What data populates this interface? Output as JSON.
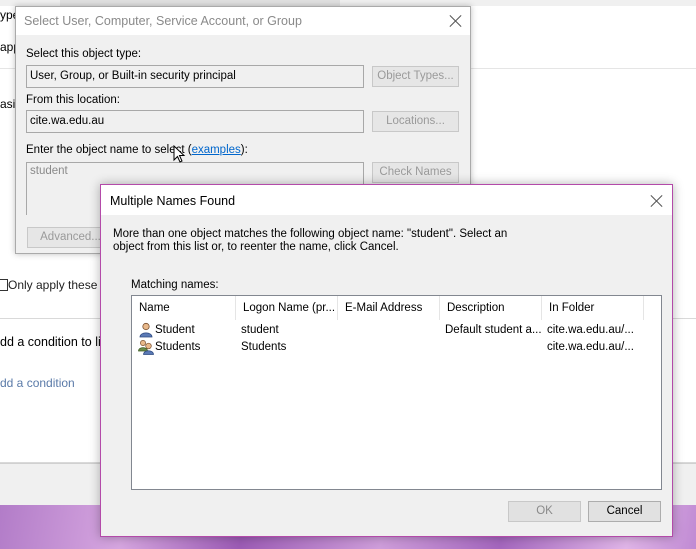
{
  "background": {
    "fragments": {
      "typ": "ype",
      "app": "app",
      "asi": "asi",
      "only_apply": "Only apply these p",
      "add_condition_to": "dd a condition to li",
      "add_condition": "dd a condition"
    }
  },
  "select_dialog": {
    "title": "Select User, Computer, Service Account, or Group",
    "object_type_label": "Select this object type:",
    "object_type_value": "User, Group, or Built-in security principal",
    "object_types_button": "Object Types...",
    "location_label": "From this location:",
    "location_value": "cite.wa.edu.au",
    "locations_button": "Locations...",
    "enter_name_label": "Enter the object name to select (",
    "examples_link": "examples",
    "enter_name_suffix": "):",
    "name_value": "student",
    "check_names_button": "Check Names",
    "advanced_button": "Advanced..."
  },
  "multiple_names_dialog": {
    "title": "Multiple Names Found",
    "message": "More than one object matches the following object name: \"student\". Select an object from this list or, to reenter the name, click Cancel.",
    "matching_label": "Matching names:",
    "columns": [
      "Name",
      "Logon Name (pr...",
      "E-Mail Address",
      "Description",
      "In Folder"
    ],
    "rows": [
      {
        "name": "Student",
        "logon": "student",
        "email": "",
        "description": "Default student a...",
        "folder": "cite.wa.edu.au/...",
        "icon": "user-icon"
      },
      {
        "name": "Students",
        "logon": "Students",
        "email": "",
        "description": "",
        "folder": "cite.wa.edu.au/...",
        "icon": "group-icon"
      }
    ],
    "ok_button": "OK",
    "cancel_button": "Cancel"
  },
  "colors": {
    "accent_border": "#b34aa9",
    "link": "#0066cc",
    "dialog_bg": "#f0f0f0"
  }
}
